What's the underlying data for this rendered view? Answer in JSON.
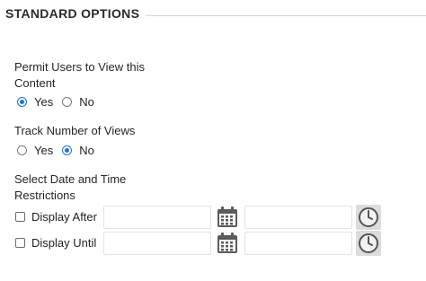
{
  "section": {
    "title": "STANDARD OPTIONS"
  },
  "permit_view": {
    "label_line1": "Permit Users to View this",
    "label_line2": "Content",
    "options": [
      {
        "label": "Yes",
        "selected": true
      },
      {
        "label": "No",
        "selected": false
      }
    ]
  },
  "track_views": {
    "label": "Track Number of Views",
    "options": [
      {
        "label": "Yes",
        "selected": false
      },
      {
        "label": "No",
        "selected": true
      }
    ]
  },
  "date_restrictions": {
    "label_line1": "Select Date and Time",
    "label_line2": "Restrictions",
    "display_after": {
      "label": "Display After",
      "checked": false,
      "date_value": "",
      "time_value": ""
    },
    "display_until": {
      "label": "Display Until",
      "checked": false,
      "date_value": "",
      "time_value": ""
    }
  },
  "icons": {
    "date_picker": "calendar-icon",
    "time_picker": "clock-icon"
  },
  "colors": {
    "accent": "#1a73e8",
    "rule": "#d6d6d6"
  }
}
